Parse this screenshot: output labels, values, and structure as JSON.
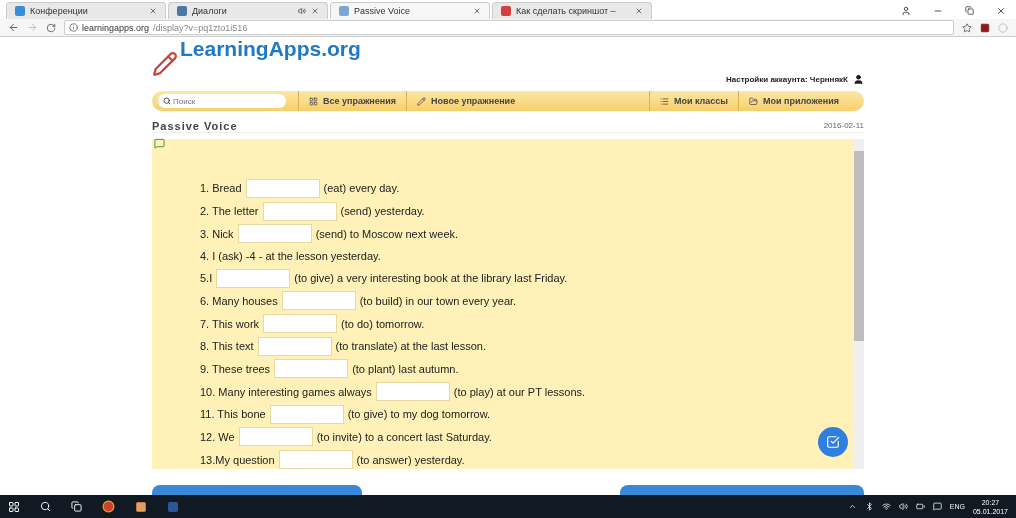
{
  "browser": {
    "tabs": [
      {
        "label": "Конференции",
        "selected": false,
        "audio": false
      },
      {
        "label": "Диалоги",
        "selected": false,
        "audio": true
      },
      {
        "label": "Passive Voice",
        "selected": true,
        "audio": false
      },
      {
        "label": "Как сделать скриншот –",
        "selected": false,
        "audio": false
      }
    ],
    "url_host": "learningapps.org",
    "url_path": "/display?v=pq1zto1i516"
  },
  "site": {
    "logo": "LearningApps.org",
    "account": "Настройки аккаунта: ЧерннякК",
    "search": {
      "placeholder": "Поиск"
    },
    "nav": [
      {
        "label": "Все упражнения"
      },
      {
        "label": "Новое упражнение"
      },
      {
        "label": "Мои классы"
      },
      {
        "label": "Мои приложения"
      }
    ]
  },
  "exercise": {
    "title": "Passive Voice",
    "date": "2016-02-11",
    "items": [
      {
        "kind": "gap",
        "before": "1. Bread",
        "after": "(eat) every day."
      },
      {
        "kind": "gap",
        "before": "2. The letter",
        "after": "(send) yesterday."
      },
      {
        "kind": "gap",
        "before": "3. Nick",
        "after": "(send) to Moscow next week."
      },
      {
        "kind": "plain",
        "before": "4. I (ask) -4 - at the lesson yesterday."
      },
      {
        "kind": "gap",
        "before": "5.I",
        "after": "(to give) a very interesting book at the library last Friday."
      },
      {
        "kind": "gap",
        "before": "6. Many houses",
        "after": "(to build) in our town every year."
      },
      {
        "kind": "gap",
        "before": "7. This work",
        "after": "(to do) tomorrow."
      },
      {
        "kind": "gap",
        "before": "8. This text",
        "after": "(to translate) at the last lesson."
      },
      {
        "kind": "gap",
        "before": "9. These trees",
        "after": "(to plant) last autumn."
      },
      {
        "kind": "gap",
        "before": "10. Many interesting games always",
        "after": "(to play) at our PT lessons."
      },
      {
        "kind": "gap",
        "before": "11. This bone",
        "after": "(to give) to my dog tomorrow."
      },
      {
        "kind": "gap",
        "before": "12. We",
        "after": "(to invite) to a concert last Saturday."
      },
      {
        "kind": "gap",
        "before": "13.My question",
        "after": "(to answer) yesterday."
      }
    ]
  },
  "taskbar": {
    "language": "ENG",
    "time": "20:27",
    "date": "05.01.2017"
  }
}
